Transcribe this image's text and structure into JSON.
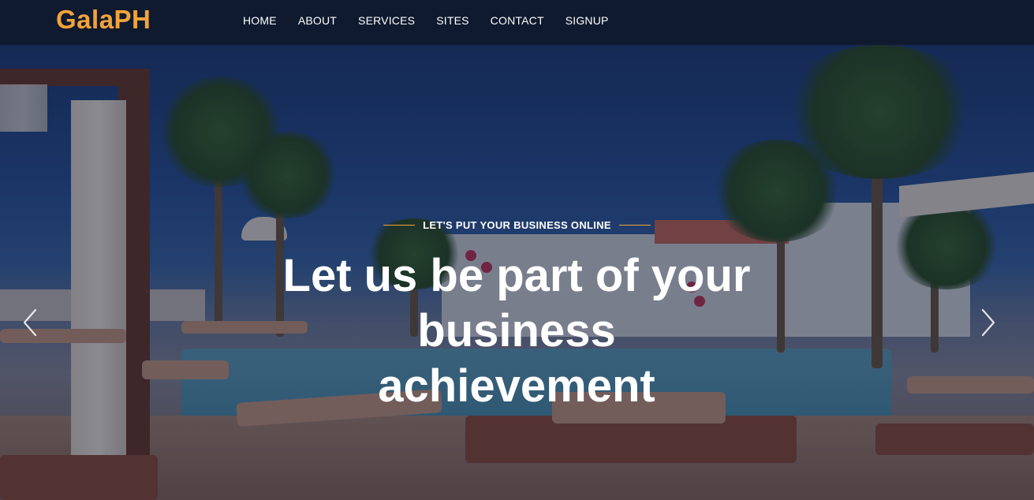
{
  "brand": {
    "name": "GalaPH",
    "color": "#f3a33a"
  },
  "nav": {
    "items": [
      {
        "label": "HOME"
      },
      {
        "label": "ABOUT"
      },
      {
        "label": "SERVICES"
      },
      {
        "label": "SITES"
      },
      {
        "label": "CONTACT"
      },
      {
        "label": "SIGNUP"
      }
    ]
  },
  "hero": {
    "eyebrow": "LET'S PUT YOUR BUSINESS ONLINE",
    "headline": "Let us be part of your business achievement",
    "accent_color": "#f3a33a",
    "background_image": "resort-pool-with-palm-trees",
    "controls": {
      "prev_icon": "chevron-left-icon",
      "next_icon": "chevron-right-icon"
    }
  },
  "theme": {
    "navbar_background": "#0f1a2e",
    "text_color": "#ffffff"
  }
}
